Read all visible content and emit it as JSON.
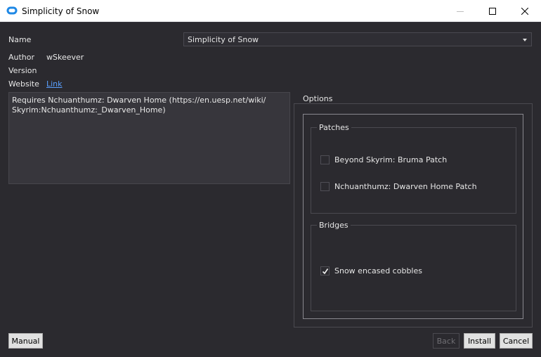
{
  "window": {
    "title": "Simplicity of Snow",
    "app_icon": "mod-organizer-icon",
    "controls": [
      "minimize-icon",
      "maximize-icon",
      "close-icon"
    ]
  },
  "info": {
    "name_label": "Name",
    "name_value": "Simplicity of Snow",
    "author_label": "Author",
    "author_value": "wSkeever",
    "version_label": "Version",
    "version_value": "",
    "website_label": "Website",
    "website_link": "Link"
  },
  "description": {
    "lines": [
      "Requires Nchuanthumz: Dwarven Home (https://en.uesp.net/wiki/",
      "Skyrim:Nchuanthumz:_Dwarven_Home)"
    ]
  },
  "options": {
    "title": "Options",
    "groups": [
      {
        "title": "Patches",
        "items": [
          {
            "label": "Beyond Skyrim: Bruma Patch",
            "checked": false
          },
          {
            "label": "Nchuanthumz: Dwarven Home Patch",
            "checked": false
          }
        ]
      },
      {
        "title": "Bridges",
        "items": [
          {
            "label": "Snow encased cobbles",
            "checked": true
          }
        ]
      }
    ]
  },
  "buttons": {
    "manual": "Manual",
    "back": "Back",
    "install": "Install",
    "cancel": "Cancel"
  },
  "colors": {
    "background": "#2b2a2f",
    "link": "#5aa0ff",
    "titlebar": "#ffffff"
  }
}
